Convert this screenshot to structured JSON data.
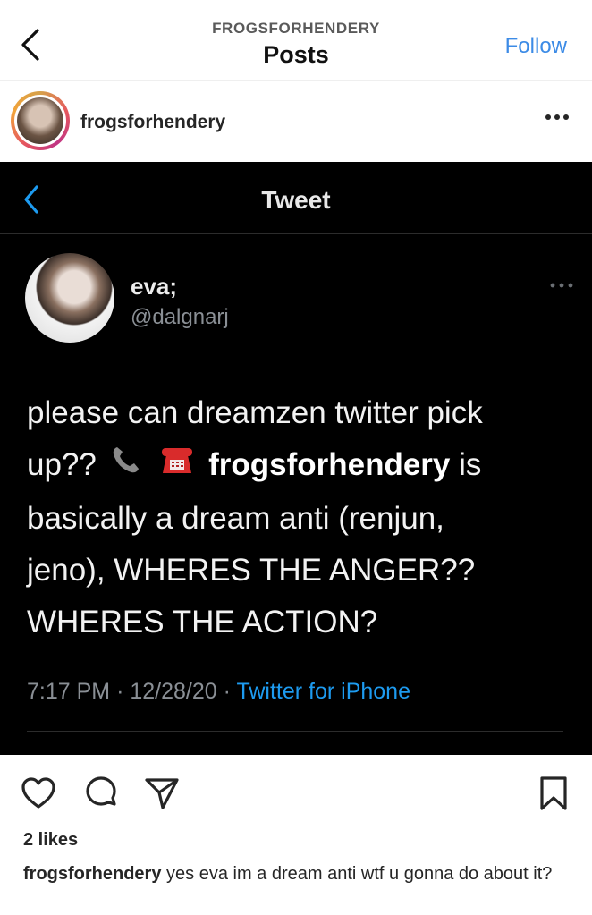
{
  "top_bar": {
    "profile_handle": "FROGSFORHENDERY",
    "title": "Posts",
    "follow_label": "Follow",
    "accent_color": "#3c8be6"
  },
  "post": {
    "username": "frogsforhendery",
    "more_icon": "more-horizontal-icon"
  },
  "tweet": {
    "header_title": "Tweet",
    "display_name": "eva;",
    "handle": "@dalgnarj",
    "text_line1": "please can dreamzen twitter pick",
    "text_line2_pre": "up??",
    "emoji_1": "telephone-receiver-icon",
    "emoji_2": "telephone-icon",
    "mention": "frogsforhendery",
    "text_line2_post": "is",
    "text_line3": "basically a dream anti (renjun,",
    "text_line4": "jeno), WHERES THE ANGER??",
    "text_line5": "WHERES THE ACTION?",
    "time": "7:17 PM",
    "separator": "·",
    "date": "12/28/20",
    "source": "Twitter for iPhone",
    "source_color": "#1d9bf0"
  },
  "actions": {
    "like_icon": "heart-icon",
    "comment_icon": "comment-icon",
    "share_icon": "send-icon",
    "save_icon": "bookmark-icon"
  },
  "likes_text": "2 likes",
  "caption": {
    "username": "frogsforhendery",
    "text": "yes eva im a dream anti wtf u gonna do about it?"
  }
}
